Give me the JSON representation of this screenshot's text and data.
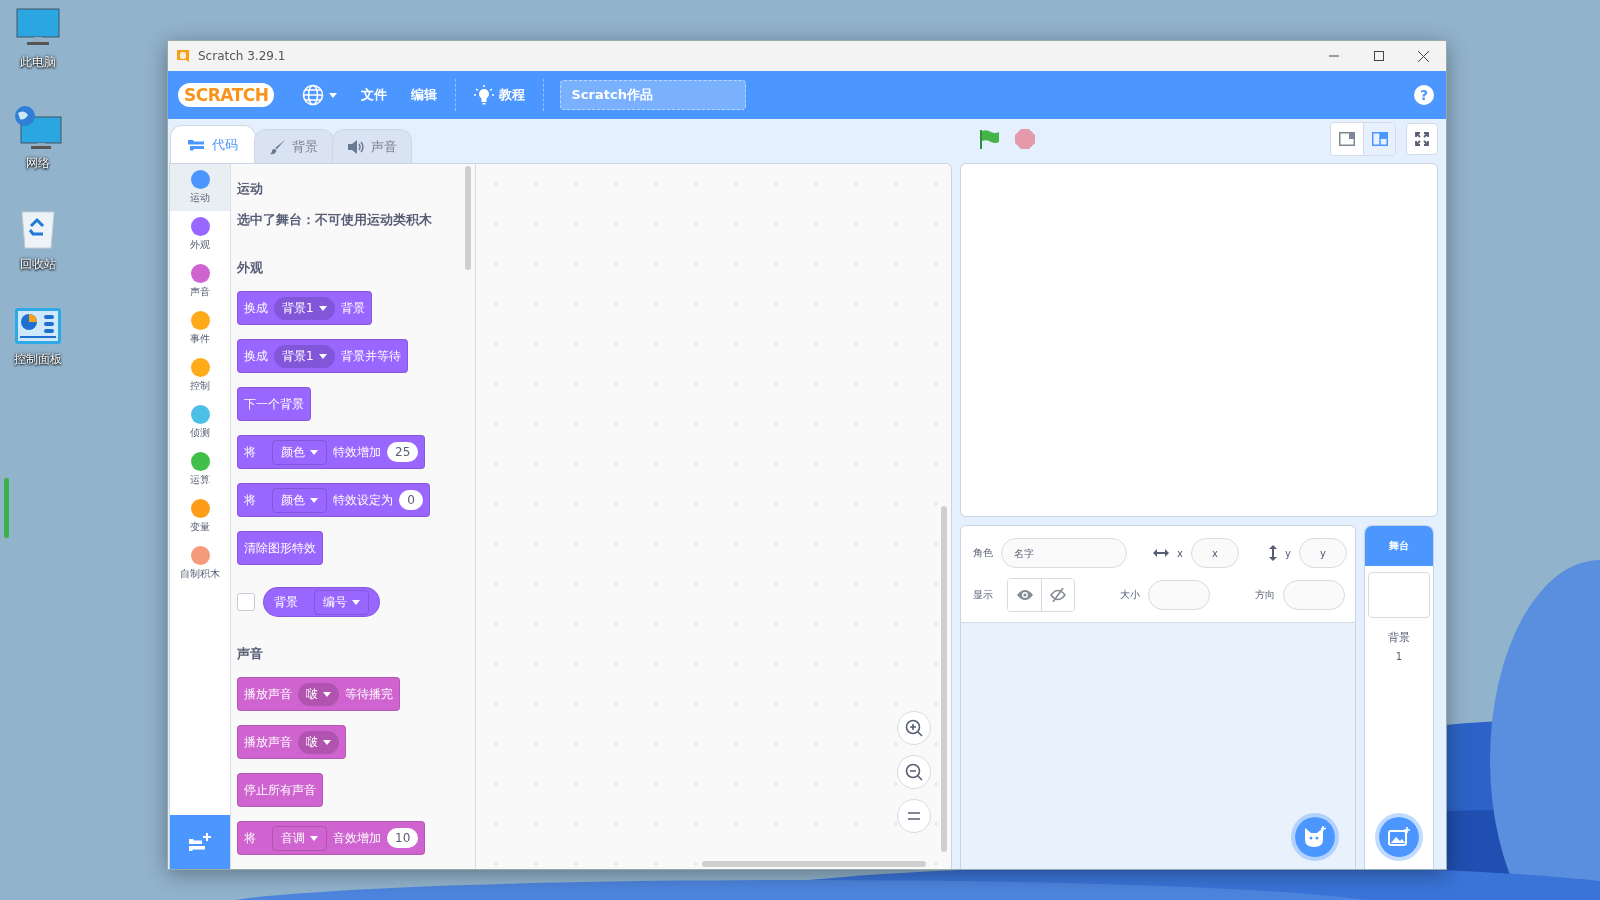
{
  "desktop": [
    {
      "label": "此电脑",
      "kind": "computer"
    },
    {
      "label": "网络",
      "kind": "network"
    },
    {
      "label": "回收站",
      "kind": "recycle-bin"
    },
    {
      "label": "控制面板",
      "kind": "control-panel"
    }
  ],
  "window": {
    "title": "Scratch 3.29.1"
  },
  "menu_bar": {
    "logo": "SCRATCH",
    "items": [
      {
        "kind": "language"
      },
      {
        "kind": "text",
        "label": "文件"
      },
      {
        "kind": "text",
        "label": "编辑"
      },
      {
        "kind": "divider"
      },
      {
        "kind": "tutorial",
        "label": "教程"
      },
      {
        "kind": "divider"
      }
    ],
    "project_title": "Scratch作品",
    "help": "?"
  },
  "tabs": [
    {
      "label": "代码",
      "kind": "code",
      "selected": true
    },
    {
      "label": "背景",
      "kind": "costume",
      "selected": false
    },
    {
      "label": "声音",
      "kind": "sound",
      "selected": false
    }
  ],
  "categories": [
    {
      "label": "运动",
      "color": "#4c97ff",
      "selected": true
    },
    {
      "label": "外观",
      "color": "#9966ff",
      "selected": false
    },
    {
      "label": "声音",
      "color": "#cf63cf",
      "selected": false
    },
    {
      "label": "事件",
      "color": "#ffab19",
      "selected": false
    },
    {
      "label": "控制",
      "color": "#ffab1a",
      "selected": false
    },
    {
      "label": "侦测",
      "color": "#4cbfe6",
      "selected": false
    },
    {
      "label": "运算",
      "color": "#40bf4a",
      "selected": false
    },
    {
      "label": "变量",
      "color": "#ff9c1a",
      "selected": false
    },
    {
      "label": "自制积木",
      "color": "#f59a7a",
      "selected": false
    }
  ],
  "palette": [
    {
      "kind": "heading",
      "text": "运动"
    },
    {
      "kind": "note",
      "text": "选中了舞台：不可使用运动类积木"
    },
    {
      "kind": "heading",
      "text": "外观"
    },
    {
      "kind": "block",
      "color": "#9966ff",
      "parts": [
        {
          "kind": "label",
          "text": "换成"
        },
        {
          "kind": "dropdown",
          "text": "背景1"
        },
        {
          "kind": "label",
          "text": "背景"
        }
      ]
    },
    {
      "kind": "block",
      "color": "#9966ff",
      "parts": [
        {
          "kind": "label",
          "text": "换成"
        },
        {
          "kind": "dropdown",
          "text": "背景1"
        },
        {
          "kind": "label",
          "text": "背景并等待"
        }
      ]
    },
    {
      "kind": "block",
      "color": "#9966ff",
      "parts": [
        {
          "kind": "label",
          "text": "下一个背景"
        }
      ]
    },
    {
      "kind": "block",
      "color": "#9966ff",
      "parts": [
        {
          "kind": "label",
          "text": "将"
        },
        {
          "kind": "menu",
          "text": "颜色"
        },
        {
          "kind": "label",
          "text": "特效增加"
        },
        {
          "kind": "number",
          "text": "25"
        }
      ]
    },
    {
      "kind": "block",
      "color": "#9966ff",
      "parts": [
        {
          "kind": "label",
          "text": "将"
        },
        {
          "kind": "menu",
          "text": "颜色"
        },
        {
          "kind": "label",
          "text": "特效设定为"
        },
        {
          "kind": "number",
          "text": "0"
        }
      ]
    },
    {
      "kind": "block",
      "color": "#9966ff",
      "parts": [
        {
          "kind": "label",
          "text": "清除图形特效"
        }
      ]
    },
    {
      "kind": "reporter",
      "color": "#9966ff",
      "checked": false,
      "parts": [
        {
          "kind": "label",
          "text": "背景"
        },
        {
          "kind": "menu",
          "text": "编号"
        }
      ]
    },
    {
      "kind": "heading",
      "text": "声音"
    },
    {
      "kind": "block",
      "color": "#cf63cf",
      "parts": [
        {
          "kind": "label",
          "text": "播放声音"
        },
        {
          "kind": "dropdown",
          "text": "啵"
        },
        {
          "kind": "label",
          "text": "等待播完"
        }
      ]
    },
    {
      "kind": "block",
      "color": "#cf63cf",
      "parts": [
        {
          "kind": "label",
          "text": "播放声音"
        },
        {
          "kind": "dropdown",
          "text": "啵"
        }
      ]
    },
    {
      "kind": "block",
      "color": "#cf63cf",
      "parts": [
        {
          "kind": "label",
          "text": "停止所有声音"
        }
      ]
    },
    {
      "kind": "block",
      "color": "#cf63cf",
      "parts": [
        {
          "kind": "label",
          "text": "将"
        },
        {
          "kind": "menu",
          "text": "音调"
        },
        {
          "kind": "label",
          "text": "音效增加"
        },
        {
          "kind": "number",
          "text": "10"
        }
      ]
    }
  ],
  "stage_header": {
    "view_modes": [
      {
        "kind": "small",
        "selected": false
      },
      {
        "kind": "normal",
        "selected": true
      }
    ]
  },
  "sprite_info": {
    "sprite_label": "角色",
    "name_placeholder": "名字",
    "x_label": "x",
    "x_placeholder": "x",
    "y_label": "y",
    "y_placeholder": "y",
    "show_label": "显示",
    "visibility": [
      {
        "kind": "show",
        "selected": false
      },
      {
        "kind": "hide",
        "selected": false
      }
    ],
    "size_label": "大小",
    "direction_label": "方向"
  },
  "stage_pane": {
    "title": "舞台",
    "backdrops_label": "背景",
    "backdrop_count": "1"
  }
}
